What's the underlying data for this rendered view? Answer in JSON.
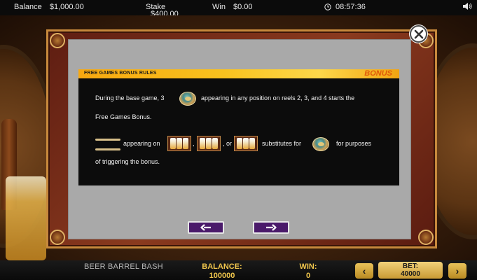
{
  "topbar": {
    "balance_label": "Balance",
    "balance_value": "$1,000.00",
    "stake_label": "Stake",
    "stake_value": "$400.00",
    "win_label": "Win",
    "win_value": "$0.00",
    "clock": "08:57:36",
    "icons": [
      "clock-icon",
      "speaker-icon"
    ]
  },
  "dialog": {
    "close_icon": "close-icon",
    "section_title": "FREE GAMES BONUS RULES",
    "section_badge": "BONUS",
    "line1_a": "During the base game, 3",
    "line1_b": "appearing in any position on reels 2, 3, and 4 starts the",
    "line2": "Free Games Bonus.",
    "line3_a": "appearing on",
    "line3_sep1": ",",
    "line3_sep2": ", or",
    "line3_b": "substitutes for",
    "line3_c": "for purposes",
    "line4": "of triggering the bonus.",
    "symbols": [
      "bonus-coin-icon",
      "wild-symbol-icon",
      "beer-symbol-icon"
    ],
    "nav": {
      "prev_icon": "arrow-left-icon",
      "next_icon": "arrow-right-icon"
    }
  },
  "bottombar": {
    "game_name": "BEER BARREL BASH",
    "balance_label": "BALANCE:",
    "balance_value": "100000",
    "win_label": "WIN:",
    "win_value": "0",
    "bet_label": "BET:",
    "bet_value": "40000",
    "bet_down": "‹",
    "bet_up": "›"
  },
  "colors": {
    "header_gold": "#f9c21e",
    "badge_orange": "#e05a0a",
    "nav_purple": "#4a1a6a",
    "stat_gold": "#f0c64c"
  }
}
